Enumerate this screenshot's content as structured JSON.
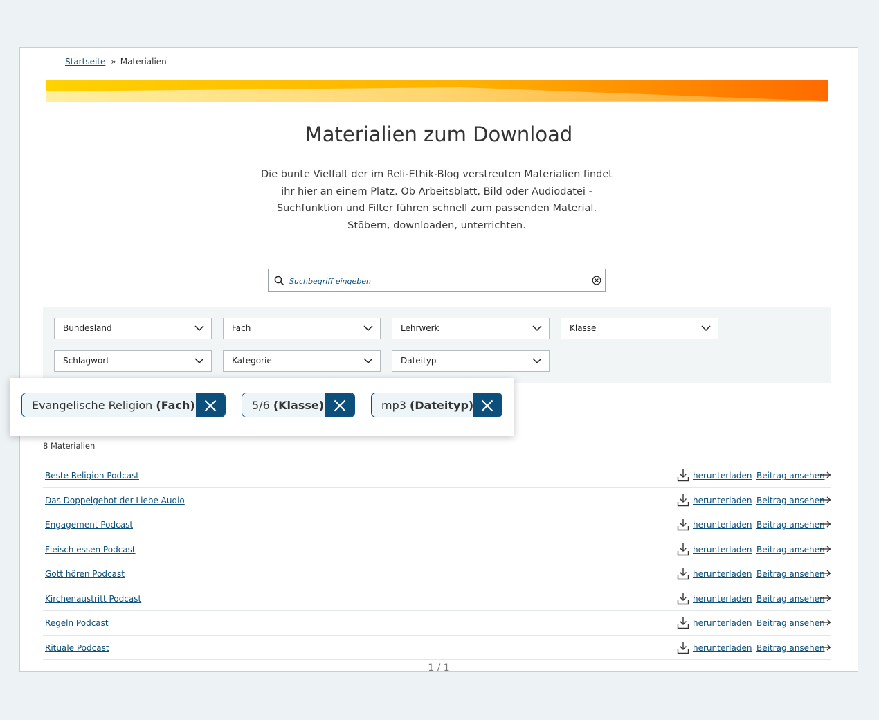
{
  "breadcrumb": {
    "home": "Startseite",
    "separator": "»",
    "current": "Materialien"
  },
  "page": {
    "title": "Materialien zum Download",
    "intro": "Die bunte Vielfalt der im Reli-Ethik-Blog verstreuten Materialien findet ihr hier an einem Platz. Ob Arbeitsblatt, Bild oder Audiodatei - Suchfunktion und Filter führen schnell zum passenden Material. Stöbern, downloaden, unterrichten."
  },
  "search": {
    "placeholder": "Suchbegriff eingeben",
    "value": ""
  },
  "filters": [
    "Bundesland",
    "Fach",
    "Lehrwerk",
    "Klasse",
    "Schlagwort",
    "Kategorie",
    "Dateityp"
  ],
  "active_filters": [
    {
      "value": "Evangelische Religion",
      "field": "(Fach)"
    },
    {
      "value": "5/6",
      "field": "(Klasse)"
    },
    {
      "value": "mp3",
      "field": "(Dateityp)"
    }
  ],
  "results": {
    "count_label": "8 Materialien",
    "download_label": "herunterladen",
    "view_label": "Beitrag ansehen",
    "items": [
      "Beste Religion Podcast",
      "Das Doppelgebot der Liebe Audio",
      "Engagement Podcast",
      "Fleisch essen Podcast",
      "Gott hören Podcast",
      "Kirchenaustritt Podcast",
      "Regeln Podcast",
      "Rituale Podcast"
    ]
  },
  "pagination": {
    "label": "1 / 1"
  },
  "colors": {
    "accent": "#0b4f7a",
    "banner_start": "#ffd200",
    "banner_end": "#ff6a00"
  },
  "icons": {
    "search": "search-icon",
    "clear": "clear-circle-icon",
    "chevron": "chevron-down-icon",
    "download": "download-icon",
    "arrow": "arrow-right-icon",
    "remove": "close-icon"
  }
}
